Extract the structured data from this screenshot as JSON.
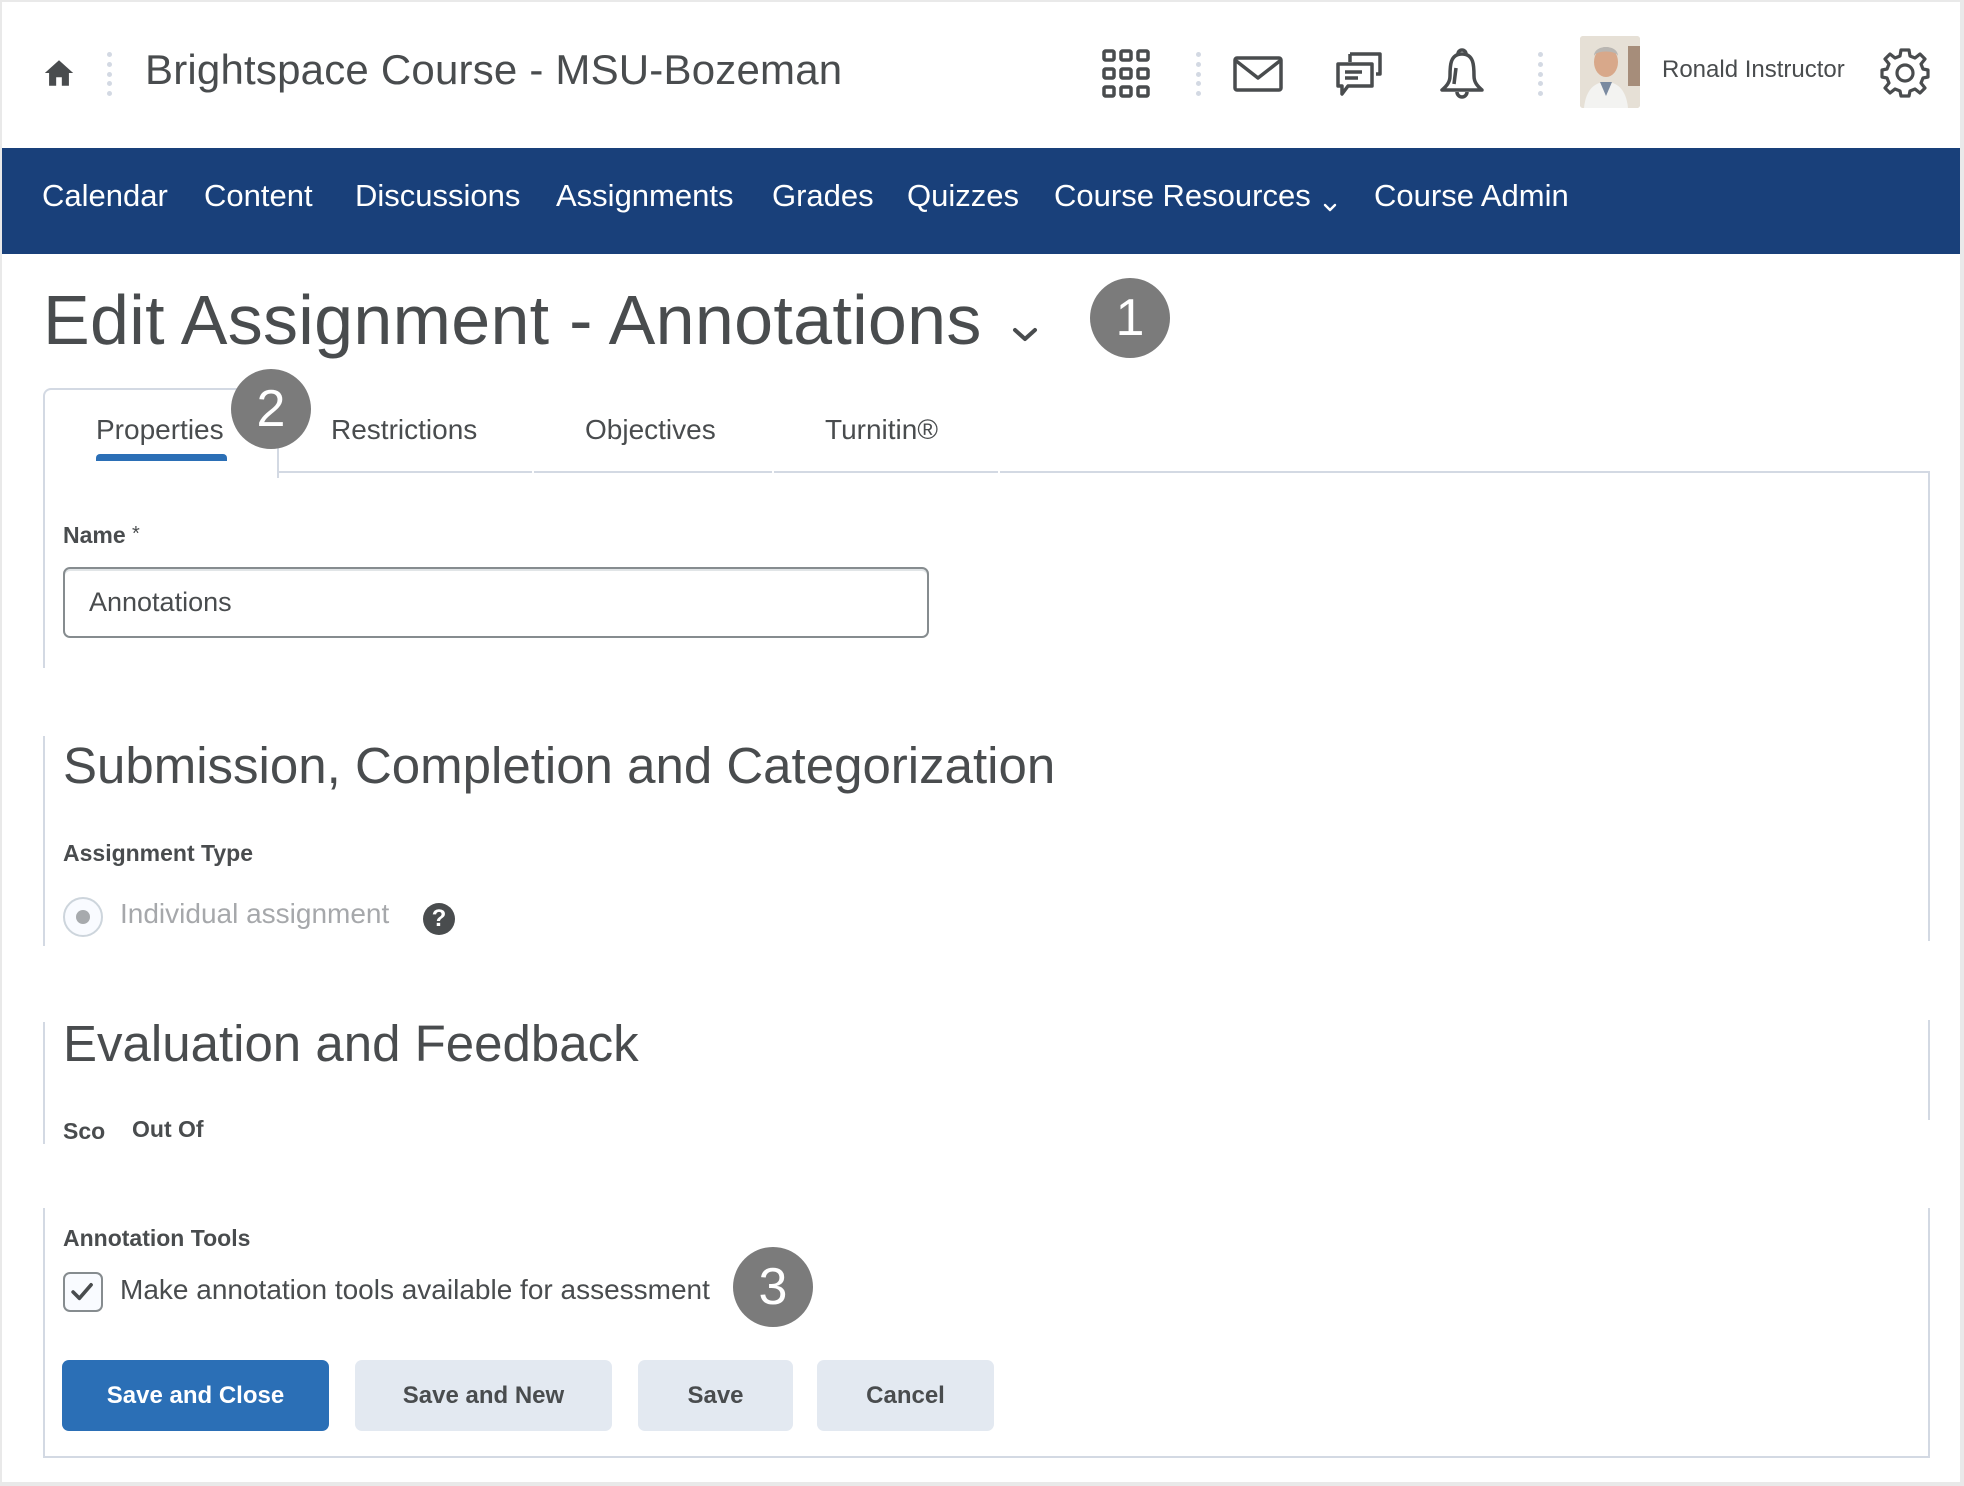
{
  "header": {
    "course_title": "Brightspace Course - MSU-Bozeman",
    "user_name": "Ronald Instructor",
    "icons": [
      "home-icon",
      "waffle-grid-icon",
      "mail-icon",
      "chat-bubbles-icon",
      "bell-icon",
      "avatar",
      "gear-icon"
    ]
  },
  "nav": {
    "items": [
      {
        "label": "Calendar"
      },
      {
        "label": "Content"
      },
      {
        "label": "Discussions"
      },
      {
        "label": "Assignments"
      },
      {
        "label": "Grades"
      },
      {
        "label": "Quizzes"
      },
      {
        "label": "Course Resources",
        "has_dropdown": true
      },
      {
        "label": "Course Admin"
      }
    ]
  },
  "page": {
    "title": "Edit Assignment - Annotations",
    "callouts": [
      "1",
      "2",
      "3"
    ]
  },
  "tabs": {
    "active": "Properties",
    "items": [
      {
        "label": "Properties"
      },
      {
        "label": "Restrictions"
      },
      {
        "label": "Objectives"
      },
      {
        "label": "Turnitin®"
      }
    ]
  },
  "properties": {
    "name_label": "Name",
    "required_marker": "*",
    "name_value": "Annotations"
  },
  "submission": {
    "heading": "Submission, Completion and Categorization",
    "assignment_type_label": "Assignment Type",
    "assignment_type_option": "Individual assignment",
    "assignment_type_selected": true,
    "assignment_type_disabled": true,
    "help_glyph": "?"
  },
  "evaluation": {
    "heading": "Evaluation and Feedback",
    "score_label_clipped": "Sco",
    "out_of_label": "Out Of"
  },
  "annotation": {
    "label": "Annotation Tools",
    "checkbox_label": "Make annotation tools available for assessment",
    "checked": true
  },
  "actions": {
    "save_and_close": "Save and Close",
    "save_and_new": "Save and New",
    "save": "Save",
    "cancel": "Cancel"
  },
  "colors": {
    "nav_bg": "#19407a",
    "primary": "#2b6fb6",
    "secondary_btn": "#e3e9f1",
    "text": "#494c4e",
    "callout_badge": "#7b7b7b",
    "border": "#d3d9e3"
  }
}
